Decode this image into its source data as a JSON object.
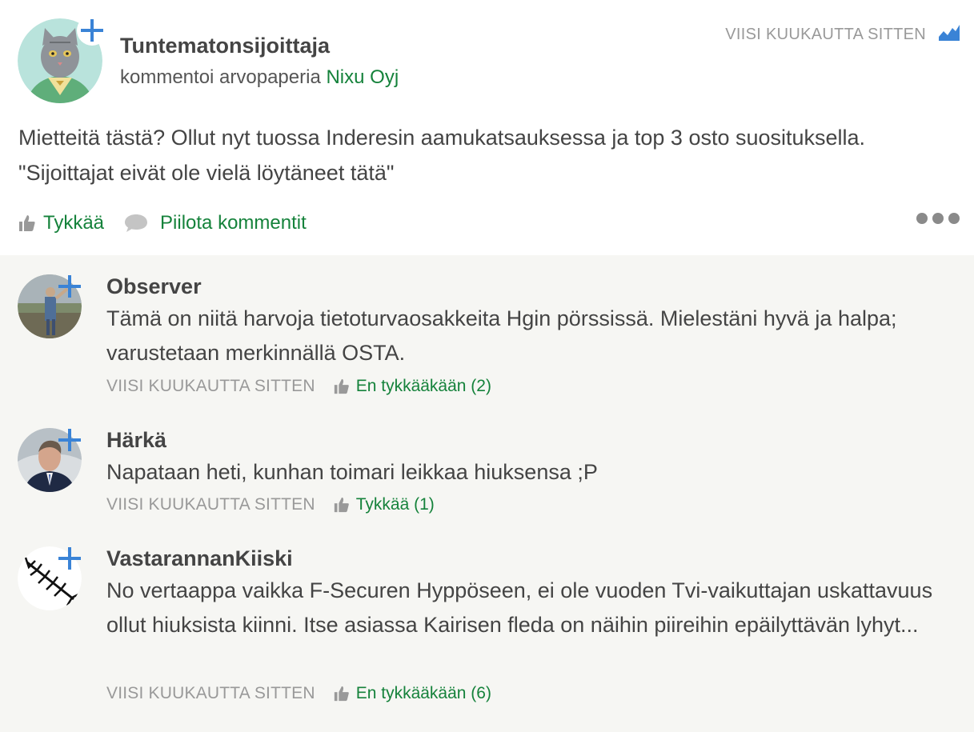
{
  "post": {
    "author": "Tuntematonsijoittaja",
    "action_text": "kommentoi arvopaperia ",
    "security_name": "Nixu Oyj",
    "timestamp": "VIISI KUUKAUTTA SITTEN",
    "body": "Mietteitä tästä? Ollut nyt tuossa Inderesin aamukatsauksessa ja top 3 osto suosituksella. \"Sijoittajat eivät ole vielä löytäneet tätä\"",
    "like_label": "Tykkää",
    "hide_comments_label": "Piilota kommentit"
  },
  "colors": {
    "accent_green": "#15823b",
    "follow_blue": "#3a83d6",
    "comments_bg": "#f6f6f3"
  },
  "comments": [
    {
      "author": "Observer",
      "text": "Tämä on niitä harvoja tietoturvaosakkeita Hgin pörssissä. Mielestäni hyvä ja halpa; varustetaan merkinnällä OSTA.",
      "timestamp": "VIISI KUUKAUTTA SITTEN",
      "like_label": "En tykkääkään (2)"
    },
    {
      "author": "Härkä",
      "text": "Napataan heti, kunhan toimari leikkaa hiuksensa ;P",
      "timestamp": "VIISI KUUKAUTTA SITTEN",
      "like_label": "Tykkää (1)"
    },
    {
      "author": "VastarannanKiiski",
      "text": "No vertaappa vaikka F-Securen Hyppöseen, ei ole vuoden Tvi-vaikuttajan uskattavuus ollut hiuksista kiinni. Itse asiassa Kairisen fleda on näihin piireihin epäilyttävän lyhyt...",
      "timestamp": "VIISI KUUKAUTTA SITTEN",
      "like_label": "En tykkääkään (6)"
    }
  ]
}
